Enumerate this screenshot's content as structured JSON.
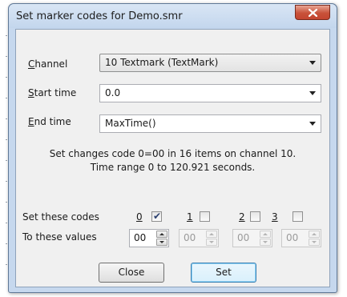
{
  "window": {
    "title": "Set marker codes for Demo.smr"
  },
  "fields": {
    "channel": {
      "label_key": "C",
      "label_rest": "hannel",
      "value": "10 Textmark (TextMark)"
    },
    "start_time": {
      "label_key": "S",
      "label_rest": "tart time",
      "value": "0.0"
    },
    "end_time": {
      "label_key": "E",
      "label_rest": "nd time",
      "value": "MaxTime()"
    }
  },
  "info": {
    "line1": "Set changes code 0=00 in 16 items on channel 10.",
    "line2": "Time range 0 to 120.921 seconds."
  },
  "codes": {
    "set_label": "Set these codes",
    "values_label": "To these values",
    "items": [
      {
        "index": "0",
        "checked": true,
        "value": "00",
        "enabled": true
      },
      {
        "index": "1",
        "checked": false,
        "value": "00",
        "enabled": false
      },
      {
        "index": "2",
        "checked": false,
        "value": "00",
        "enabled": false
      },
      {
        "index": "3",
        "checked": false,
        "value": "00",
        "enabled": false
      }
    ]
  },
  "buttons": {
    "close_label": "Close",
    "set_label": "Set"
  },
  "icons": {
    "close": "close-icon",
    "check": "check-icon"
  }
}
